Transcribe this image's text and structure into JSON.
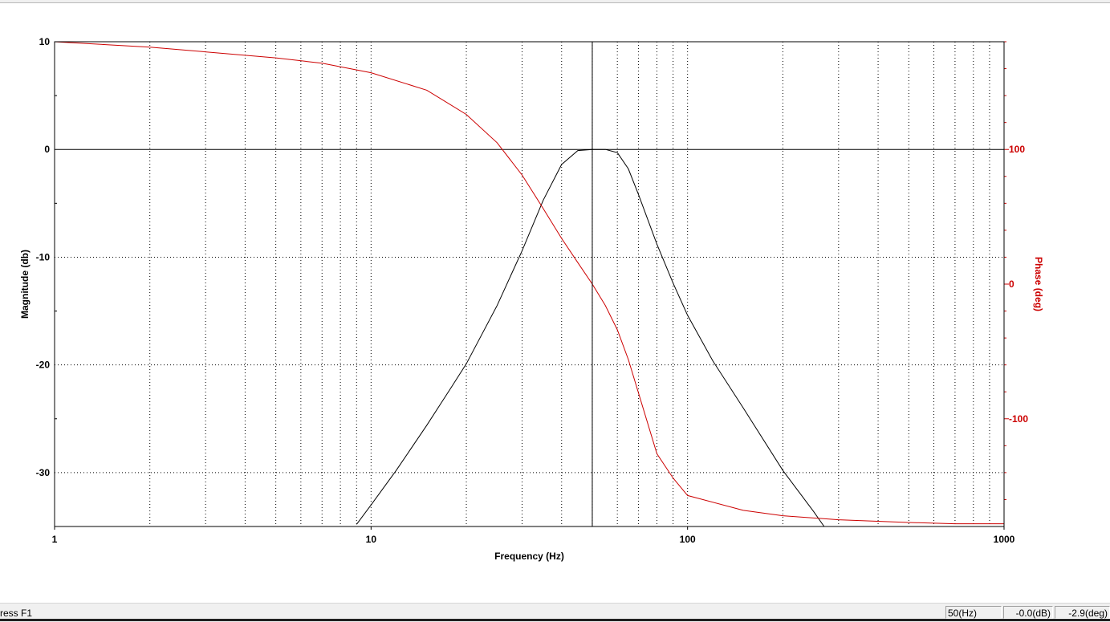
{
  "chart_data": {
    "type": "line",
    "title": "",
    "xlabel": "Frequency (Hz)",
    "ylabel": "Magnitude (db)",
    "y2label": "Phase (deg)",
    "x_scale": "log",
    "xlim": [
      1,
      1000
    ],
    "ylim": [
      -35,
      10
    ],
    "y2lim": [
      -180,
      180
    ],
    "x_ticks": [
      {
        "value": 1,
        "label": "1"
      },
      {
        "value": 10,
        "label": "10"
      },
      {
        "value": 100,
        "label": "100"
      },
      {
        "value": 1000,
        "label": "1000"
      }
    ],
    "y_ticks": [
      {
        "value": 10,
        "label": "10"
      },
      {
        "value": 0,
        "label": "0"
      },
      {
        "value": -10,
        "label": "-10"
      },
      {
        "value": -20,
        "label": "-20"
      },
      {
        "value": -30,
        "label": "-30"
      }
    ],
    "y2_ticks": [
      {
        "value": 100,
        "label": "100"
      },
      {
        "value": 0,
        "label": "0"
      },
      {
        "value": -100,
        "label": "-100"
      }
    ],
    "grid": true,
    "cursor_x": 50,
    "colors": {
      "magnitude": "#000000",
      "phase": "#cc0000",
      "grid": "#000000"
    },
    "series": [
      {
        "axis": "left",
        "color": "#000000",
        "x": [
          9,
          10,
          12,
          15,
          18,
          20,
          25,
          30,
          35,
          40,
          45,
          50,
          55,
          60,
          65,
          70,
          80,
          90,
          100,
          120,
          150,
          200,
          250,
          270
        ],
        "y": [
          -34.8,
          -33,
          -29.8,
          -25.6,
          -22,
          -19.9,
          -14.5,
          -9.4,
          -4.7,
          -1.4,
          -0.1,
          0,
          0,
          -0.3,
          -1.8,
          -4.2,
          -8.8,
          -12.4,
          -15.4,
          -19.6,
          -24,
          -29.8,
          -33.6,
          -35
        ]
      },
      {
        "axis": "right",
        "color": "#cc0000",
        "x": [
          1,
          2,
          5,
          7,
          10,
          15,
          20,
          25,
          30,
          35,
          40,
          45,
          50,
          55,
          60,
          65,
          70,
          80,
          90,
          100,
          150,
          200,
          300,
          500,
          700,
          1000
        ],
        "y": [
          180,
          176,
          168,
          164,
          157,
          144,
          126,
          105,
          81,
          56,
          34,
          16,
          0,
          -16,
          -34,
          -56,
          -81,
          -126,
          -144,
          -157,
          -168,
          -172,
          -175,
          -177,
          -178,
          -178
        ]
      }
    ]
  },
  "status": {
    "hint": "ress F1",
    "frequency": "50(Hz)",
    "magnitude": "-0.0(dB)",
    "phase": "-2.9(deg)"
  }
}
